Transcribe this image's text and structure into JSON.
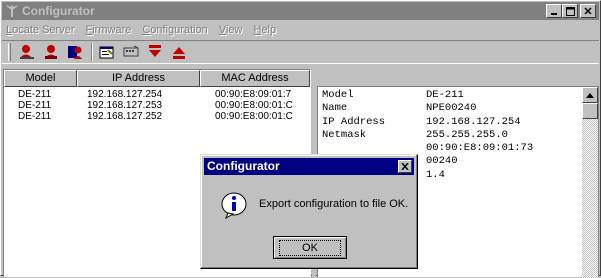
{
  "window": {
    "title": "Configurator"
  },
  "menu": [
    {
      "label": "Locate Server",
      "accel": "L",
      "rest": "ocate Server"
    },
    {
      "label": "Firmware",
      "accel": "F",
      "rest": "irmware"
    },
    {
      "label": "Configuration",
      "accel": "C",
      "rest": "onfiguration"
    },
    {
      "label": "View",
      "accel": "V",
      "rest": "iew"
    },
    {
      "label": "Help",
      "accel": "H",
      "rest": "elp"
    }
  ],
  "toolbar_icons": [
    "locate-server-icon",
    "remove-server-icon",
    "unlock-server-icon",
    "properties-icon",
    "network-icon",
    "export-icon",
    "import-icon"
  ],
  "list": {
    "columns": [
      "Model",
      "IP Address",
      "MAC Address"
    ],
    "rows": [
      {
        "model": "DE-211",
        "ip": "192.168.127.254",
        "mac": "00:90:E8:09:01:7"
      },
      {
        "model": "DE-211",
        "ip": "192.168.127.253",
        "mac": "00:90:E8:00:01:C"
      },
      {
        "model": "DE-211",
        "ip": "192.168.127.252",
        "mac": "00:90:E8:00:01:C"
      }
    ]
  },
  "details": [
    {
      "key": "Model",
      "value": "DE-211"
    },
    {
      "key": "Name",
      "value": "NPE00240"
    },
    {
      "key": "IP Address",
      "value": "192.168.127.254"
    },
    {
      "key": "Netmask",
      "value": "255.255.255.0"
    },
    {
      "key": "",
      "value": ""
    },
    {
      "key": "",
      "value": "00:90:E8:09:01:73"
    },
    {
      "key": "",
      "value": "00240"
    },
    {
      "key": "",
      "value": "1.4"
    }
  ],
  "dialog": {
    "title": "Configurator",
    "message": "Export configuration to file OK.",
    "ok_label": "OK"
  },
  "colors": {
    "title_inactive": "#808080",
    "dialog_title": "#000080",
    "face": "#c0c0c0"
  }
}
